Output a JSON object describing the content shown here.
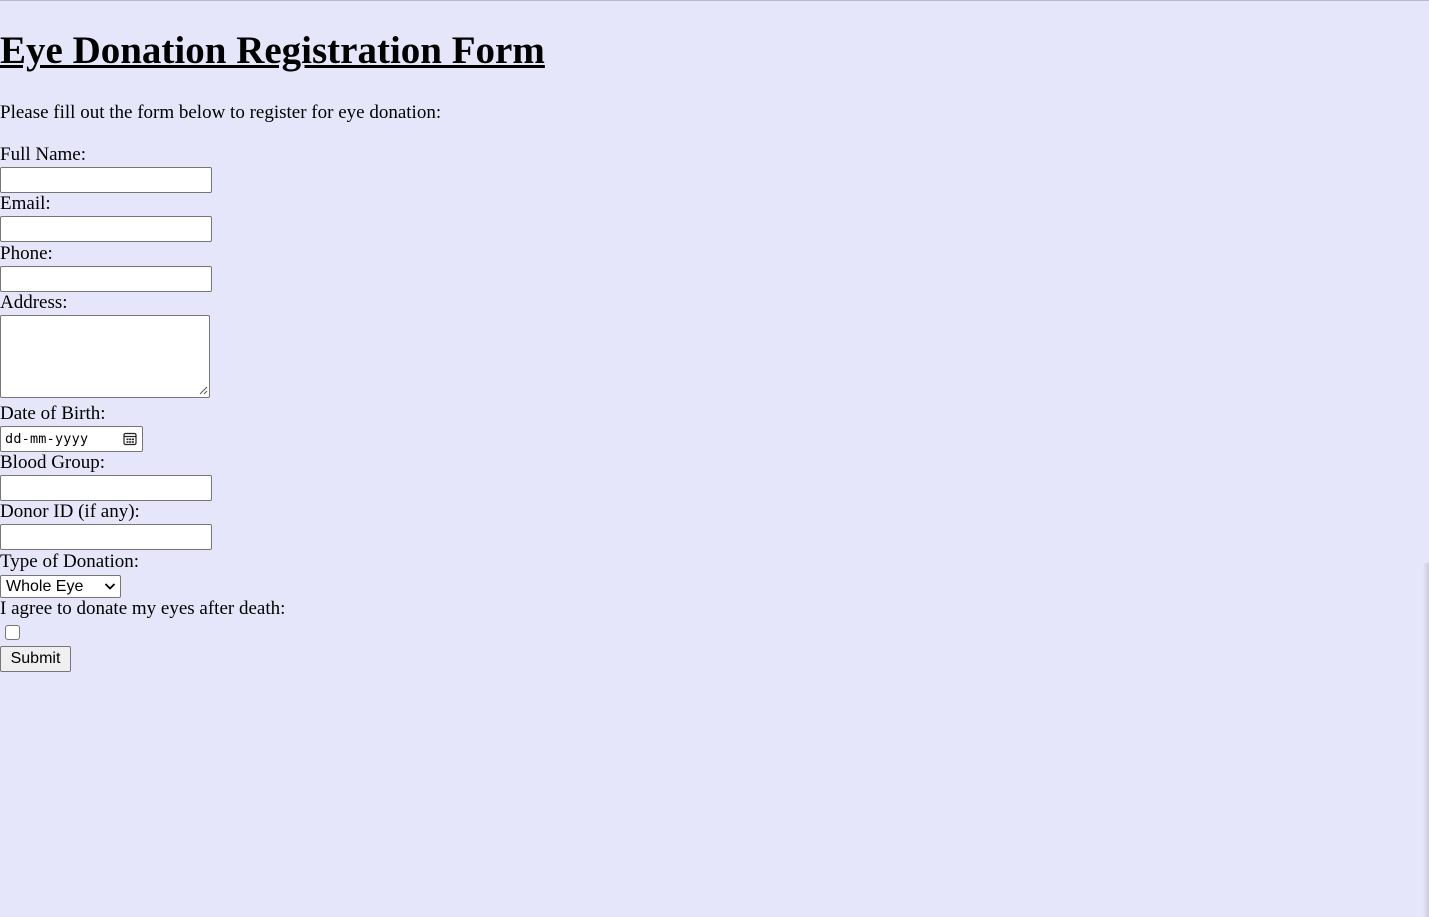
{
  "form": {
    "title": "Eye Donation Registration Form",
    "intro": "Please fill out the form below to register for eye donation:",
    "fields": {
      "full_name": {
        "label": "Full Name:",
        "value": ""
      },
      "email": {
        "label": "Email:",
        "value": ""
      },
      "phone": {
        "label": "Phone:",
        "value": ""
      },
      "address": {
        "label": "Address:",
        "value": ""
      },
      "dob": {
        "label": "Date of Birth:",
        "placeholder": "dd-mm-yyyy"
      },
      "blood_group": {
        "label": "Blood Group:",
        "value": ""
      },
      "donor_id": {
        "label": "Donor ID (if any):",
        "value": ""
      },
      "donation_type": {
        "label": "Type of Donation:",
        "selected": "Whole Eye"
      },
      "consent": {
        "label": "I agree to donate my eyes after death:",
        "checked": false
      }
    },
    "submit_label": "Submit"
  },
  "colors": {
    "background": "#e6e6fa",
    "input_border": "#767676",
    "button_bg": "#efefef"
  },
  "icons": {
    "date": "calendar-icon",
    "select": "chevron-down-icon",
    "textarea": "resize-grip-icon"
  }
}
